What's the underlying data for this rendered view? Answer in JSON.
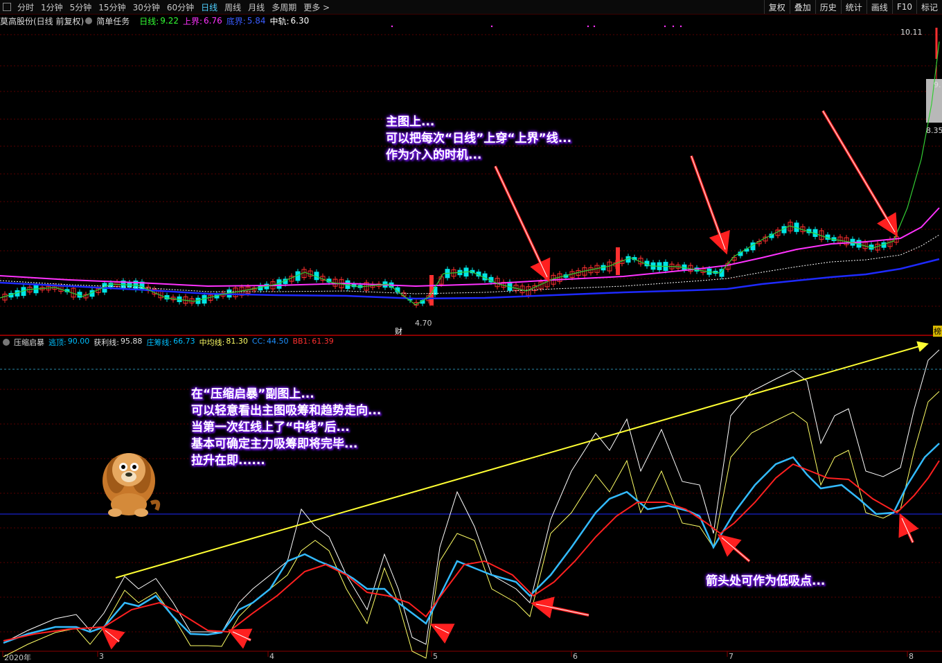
{
  "toolbar": {
    "periods": [
      "分时",
      "1分钟",
      "5分钟",
      "15分钟",
      "30分钟",
      "60分钟",
      "日线",
      "周线",
      "月线",
      "多周期",
      "更多 >"
    ],
    "active_period": "日线",
    "right_buttons": [
      "复权",
      "叠加",
      "历史",
      "统计",
      "画线",
      "F10",
      "标记"
    ]
  },
  "main_info": {
    "stock": "莫高股份(日线 前复权)",
    "indicator": "简单任务",
    "daily_label": "日线:",
    "daily_value": "9.22",
    "upper_label": "上界:",
    "upper_value": "6.76",
    "lower_label": "底界:",
    "lower_value": "5.84",
    "mid_label": "中轨:",
    "mid_value": "6.30"
  },
  "price_labels": {
    "high": "10.11",
    "mid": "9.",
    "low_ref": "8.35",
    "min": "4.70",
    "fin_marker": "财",
    "rank_marker": "榜"
  },
  "sub_info": {
    "name": "压缩启暴",
    "items": [
      {
        "label": "逃顶:",
        "value": "90.00",
        "color": "#00bfff"
      },
      {
        "label": "获利线:",
        "value": "95.88",
        "color": "#e0e0e0"
      },
      {
        "label": "庄筹线:",
        "value": "66.73",
        "color": "#00bfff"
      },
      {
        "label": "中均线:",
        "value": "81.30",
        "color": "#ffff66"
      },
      {
        "label": "CC:",
        "value": "44.50",
        "color": "#1e90ff"
      },
      {
        "label": "BB1:",
        "value": "61.39",
        "color": "#ff3030"
      }
    ]
  },
  "date_axis": [
    "2020年",
    "3",
    "4",
    "5",
    "6",
    "7",
    "8"
  ],
  "notes": {
    "main": [
      "主图上...",
      "可以把每次“日线”上穿“上界”线...",
      "作为介入的时机..."
    ],
    "sub": [
      "在“压缩启暴”副图上...",
      "可以轻意看出主图吸筹和趋势走向...",
      "当第一次红线上了“中线”后...",
      "基本可确定主力吸筹即将完毕...",
      "拉升在即......"
    ],
    "arrow": "箭头处可作为低吸点..."
  },
  "colors": {
    "up": "#ff3030",
    "down": "#00e5e5",
    "upper_line": "#ff33ff",
    "mid_line": "#ffffff",
    "lower_line": "#1e2aff",
    "daily_line": "#33cc33",
    "note_glow": "#7a1cf0",
    "trend_arrow": "#ffff33"
  },
  "mascot": "cartoon-lion-dog"
}
